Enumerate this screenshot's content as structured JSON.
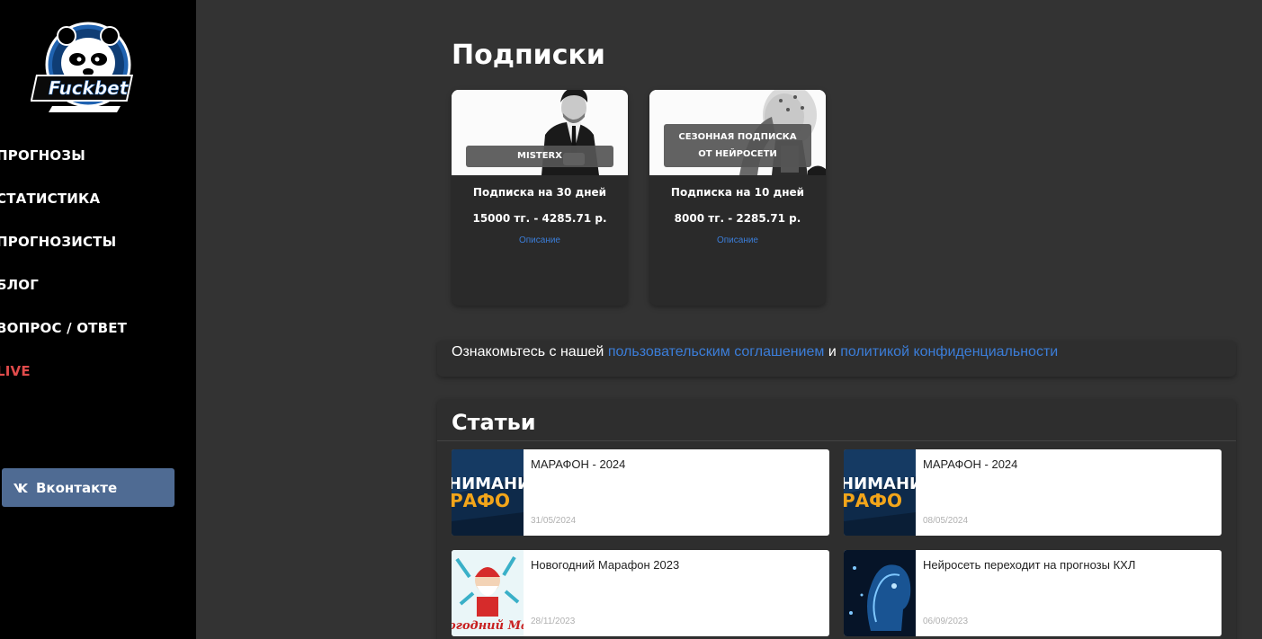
{
  "sidebar": {
    "logo_text": "Fuckbet",
    "nav": [
      {
        "label": "ПРОГНОЗЫ"
      },
      {
        "label": "СТАТИСТИКА"
      },
      {
        "label": "ПРОГНОЗИСТЫ"
      },
      {
        "label": "БЛОГ"
      },
      {
        "label": "ВОПРОС / ОТВЕТ"
      },
      {
        "label": "LIVE"
      }
    ],
    "vk_button": {
      "icon": "vk-icon",
      "label": "Вконтакте"
    }
  },
  "subscriptions": {
    "title": "Подписки",
    "cards": [
      {
        "badge": "MISTERX",
        "title": "Подписка на 30 дней",
        "price": "15000 тг. - 4285.71 р.",
        "link": "Описание"
      },
      {
        "badge_line1": "СЕЗОННАЯ ПОДПИСКА",
        "badge_line2": "ОТ НЕЙРОСЕТИ",
        "title": "Подписка на 10 дней",
        "price": "8000 тг. - 2285.71 р.",
        "link": "Описание"
      }
    ]
  },
  "agreement": {
    "prefix": "Ознакомьтесь с нашей",
    "link1": "пользовательским соглашением",
    "middle": "и",
    "link2": "политикой конфиденциальности"
  },
  "articles": {
    "title": "Статьи",
    "items": [
      {
        "title": "МАРАФОН - 2024",
        "date": "31/05/2024",
        "thumb_text_top": "НИМАНИ",
        "thumb_text_bottom": "РАФО"
      },
      {
        "title": "МАРАФОН - 2024",
        "date": "08/05/2024",
        "thumb_text_top": "НИМАНИ",
        "thumb_text_bottom": "РАФО"
      },
      {
        "title": "Новогодний Марафон 2023",
        "date": "28/11/2023",
        "thumb_text_bottom": "огодний Мара"
      },
      {
        "title": "Нейросеть переходит на прогнозы КХЛ",
        "date": "06/09/2023"
      }
    ]
  },
  "colors": {
    "sidebar_bg": "#000000",
    "main_bg": "#333333",
    "link": "#3b7dd8",
    "live": "#e04b4b",
    "vk_button": "#4f6b93"
  }
}
